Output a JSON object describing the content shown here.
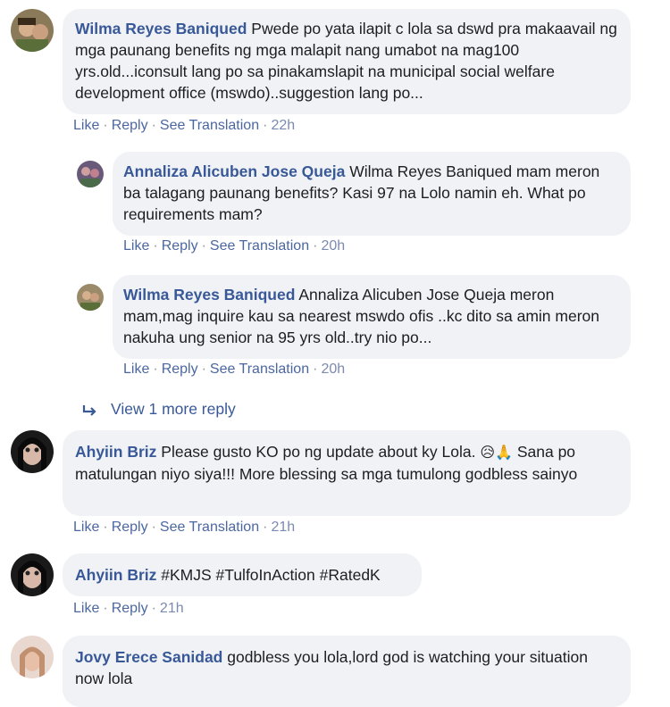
{
  "comments": [
    {
      "author": "Wilma Reyes Baniqued",
      "text": "Pwede po yata ilapit c lola sa dswd pra makaavail ng mga paunang benefits ng mga malapit nang umabot na mag100 yrs.old...iconsult lang po sa pinakamslapit na municipal social welfare development office (mswdo)..suggestion lang po...",
      "actions": [
        "Like",
        "Reply",
        "See Translation"
      ],
      "time": "22h"
    },
    {
      "author": "Annaliza Alicuben Jose Queja",
      "text": "Wilma Reyes Baniqued mam meron ba talagang paunang benefits? Kasi 97 na Lolo namin eh. What po requirements mam?",
      "actions": [
        "Like",
        "Reply",
        "See Translation"
      ],
      "time": "20h"
    },
    {
      "author": "Wilma Reyes Baniqued",
      "text": "Annaliza Alicuben Jose Queja meron mam,mag inquire kau sa nearest mswdo ofis ..kc dito sa amin meron nakuha ung senior na 95 yrs old..try nio po...",
      "actions": [
        "Like",
        "Reply",
        "See Translation"
      ],
      "time": "20h"
    },
    {
      "author": "Ahyiin Briz",
      "text": "Please gusto KO po ng update about ky Lola.",
      "emoji": "😥🙏",
      "text2": "Sana po matulungan niyo siya!!! More blessing sa mga tumulong godbless sainyo",
      "actions": [
        "Like",
        "Reply",
        "See Translation"
      ],
      "time": "21h"
    },
    {
      "author": "Ahyiin Briz",
      "text": "#KMJS #TulfoInAction #RatedK",
      "actions": [
        "Like",
        "Reply"
      ],
      "time": "21h"
    },
    {
      "author": "Jovy Erece Sanidad",
      "text": "godbless you lola,lord god is watching your situation now lola",
      "actions": [],
      "time": ""
    }
  ],
  "view_more": "View 1 more reply",
  "colors": {
    "link": "#385898",
    "bubble": "#f0f2f5",
    "meta": "#7b8ab0"
  }
}
